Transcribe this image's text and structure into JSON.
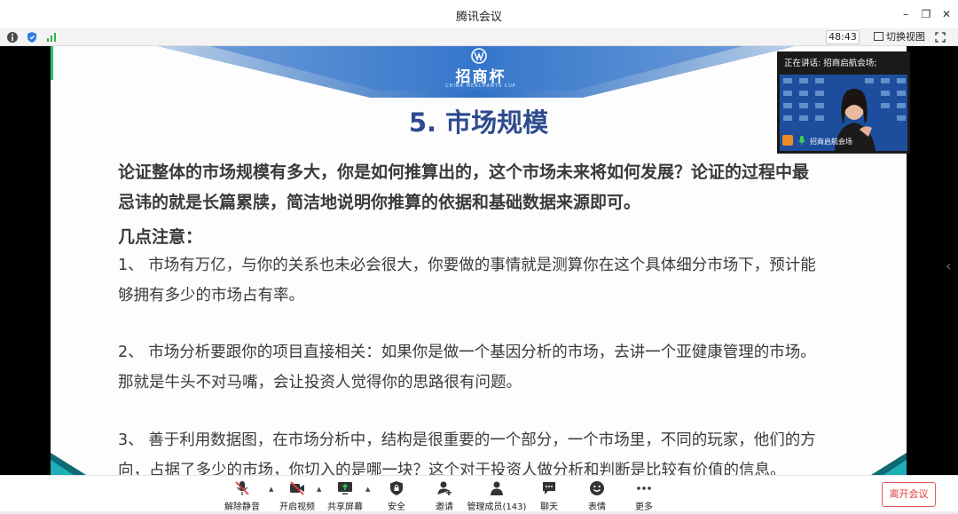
{
  "window": {
    "title": "腾讯会议",
    "minimize": "–",
    "restore": "❐",
    "close": "✕"
  },
  "statusbar": {
    "timer": "48:43",
    "switch_view": "切换视图"
  },
  "slide": {
    "logo": "招商杯",
    "logo_sub": "CHINA MERCHANTS CUP",
    "title": "5. 市场规模",
    "intro_line1": "论证整体的市场规模有多大，你是如何推算出的，这个市场未来将如何发展？论证的过程中最",
    "intro_line2": "忌讳的就是长篇累牍，简洁地说明你推算的依据和基础数据来源即可。",
    "notes_heading": "几点注意：",
    "point1_line1": "1、 市场有万亿，与你的关系也未必会很大，你要做的事情就是测算你在这个具体细分市场下，预计能",
    "point1_line2": "够拥有多少的市场占有率。",
    "point2_line1": "2、 市场分析要跟你的项目直接相关：如果你是做一个基因分析的市场，去讲一个亚健康管理的市场。",
    "point2_line2": "那就是牛头不对马嘴，会让投资人觉得你的思路很有问题。",
    "point3_line1": "3、 善于利用数据图，在市场分析中，结构是很重要的一个部分，一个市场里，不同的玩家，他们的方",
    "point3_line2": "向，占据了多少的市场，你切入的是哪一块？这个对于投资人做分析和判断是比较有价值的信息。"
  },
  "video": {
    "speaking": "正在讲话: 招商启航会场;",
    "name": "招商启航会场"
  },
  "toolbar": {
    "items": [
      {
        "label": "解除静音",
        "icon": "mic-muted-icon"
      },
      {
        "label": "开启视频",
        "icon": "camera-off-icon"
      },
      {
        "label": "共享屏幕",
        "icon": "share-screen-icon"
      },
      {
        "label": "安全",
        "icon": "shield-icon"
      },
      {
        "label": "邀请",
        "icon": "invite-icon"
      },
      {
        "label": "管理成员(143)",
        "icon": "members-icon"
      },
      {
        "label": "聊天",
        "icon": "chat-icon"
      },
      {
        "label": "表情",
        "icon": "emoji-icon"
      },
      {
        "label": "更多",
        "icon": "more-icon"
      }
    ],
    "leave": "离开会议"
  },
  "colors": {
    "title_blue": "#2e4b8e",
    "leave_red": "#e23b3b",
    "speaker_green": "#27c46b"
  }
}
